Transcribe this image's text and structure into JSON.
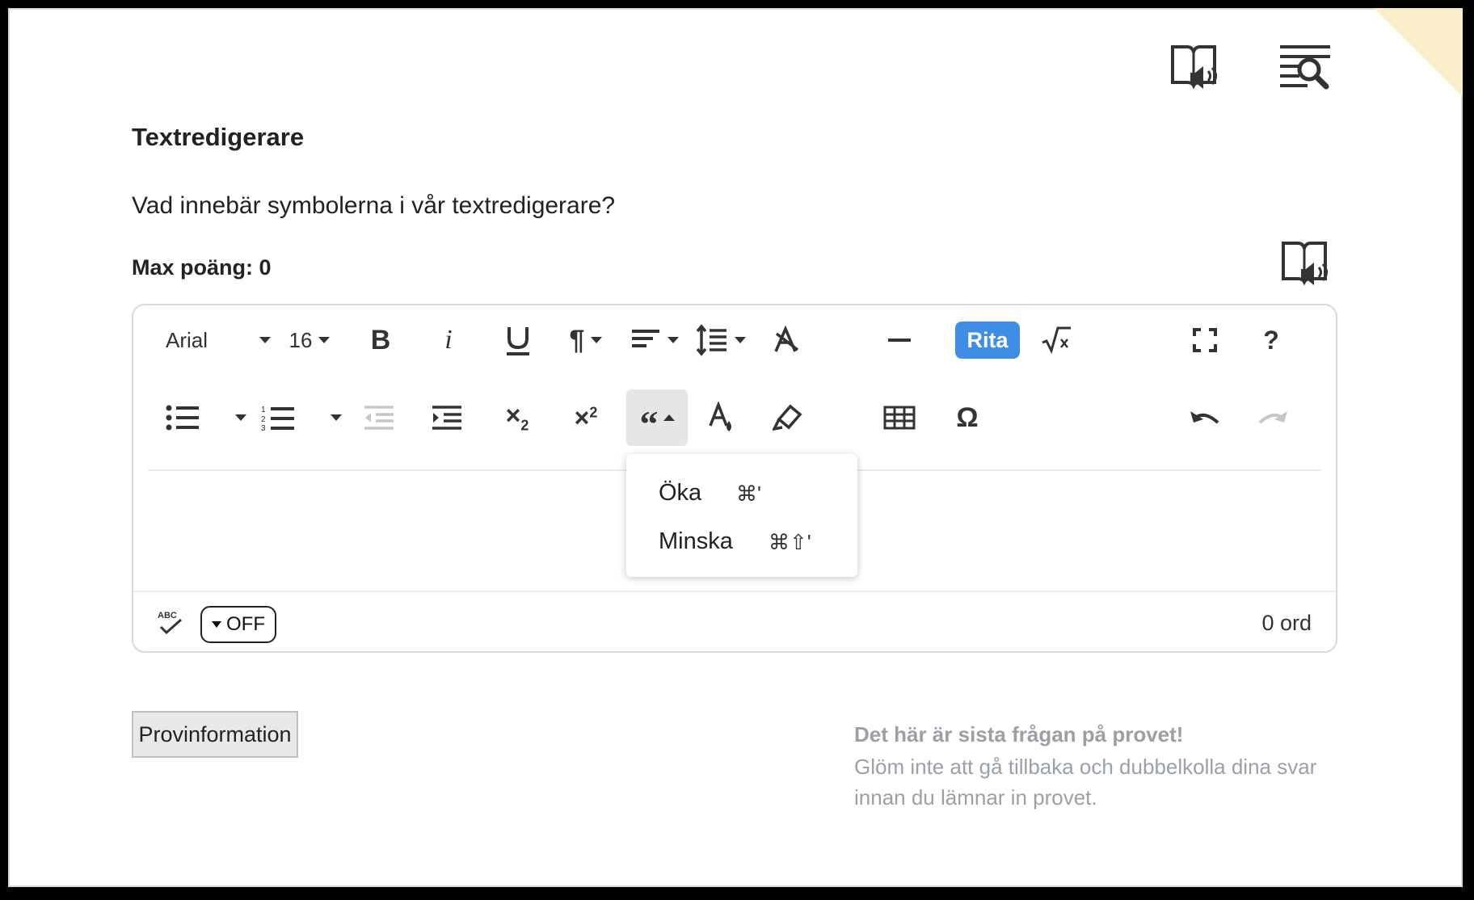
{
  "page": {
    "title": "Textredigerare",
    "question": "Vad innebär symbolerna i vår textredigerare?",
    "max_points": "Max poäng: 0"
  },
  "top_icons": [
    "read-aloud-icon",
    "search-lines-icon"
  ],
  "toolbar": {
    "font": "Arial",
    "size": "16",
    "rita_label": "Rita",
    "help_label": "?"
  },
  "dropdown": {
    "items": [
      {
        "label": "Öka",
        "shortcut": "⌘'"
      },
      {
        "label": "Minska",
        "shortcut": "⌘⇧'"
      }
    ]
  },
  "footer": {
    "spell_label": "ABC",
    "spell_toggle": "OFF",
    "word_count": "0 ord"
  },
  "actions": {
    "info_button": "Provinformation"
  },
  "notice": {
    "title": "Det här är sista frågan på provet!",
    "body": "Glöm inte att gå tillbaka och dubbelkolla dina svar innan du lämnar in provet."
  },
  "colors": {
    "accent": "#3e8ee5",
    "muted_text": "#9aa0a6",
    "corner": "#fbeeca"
  }
}
